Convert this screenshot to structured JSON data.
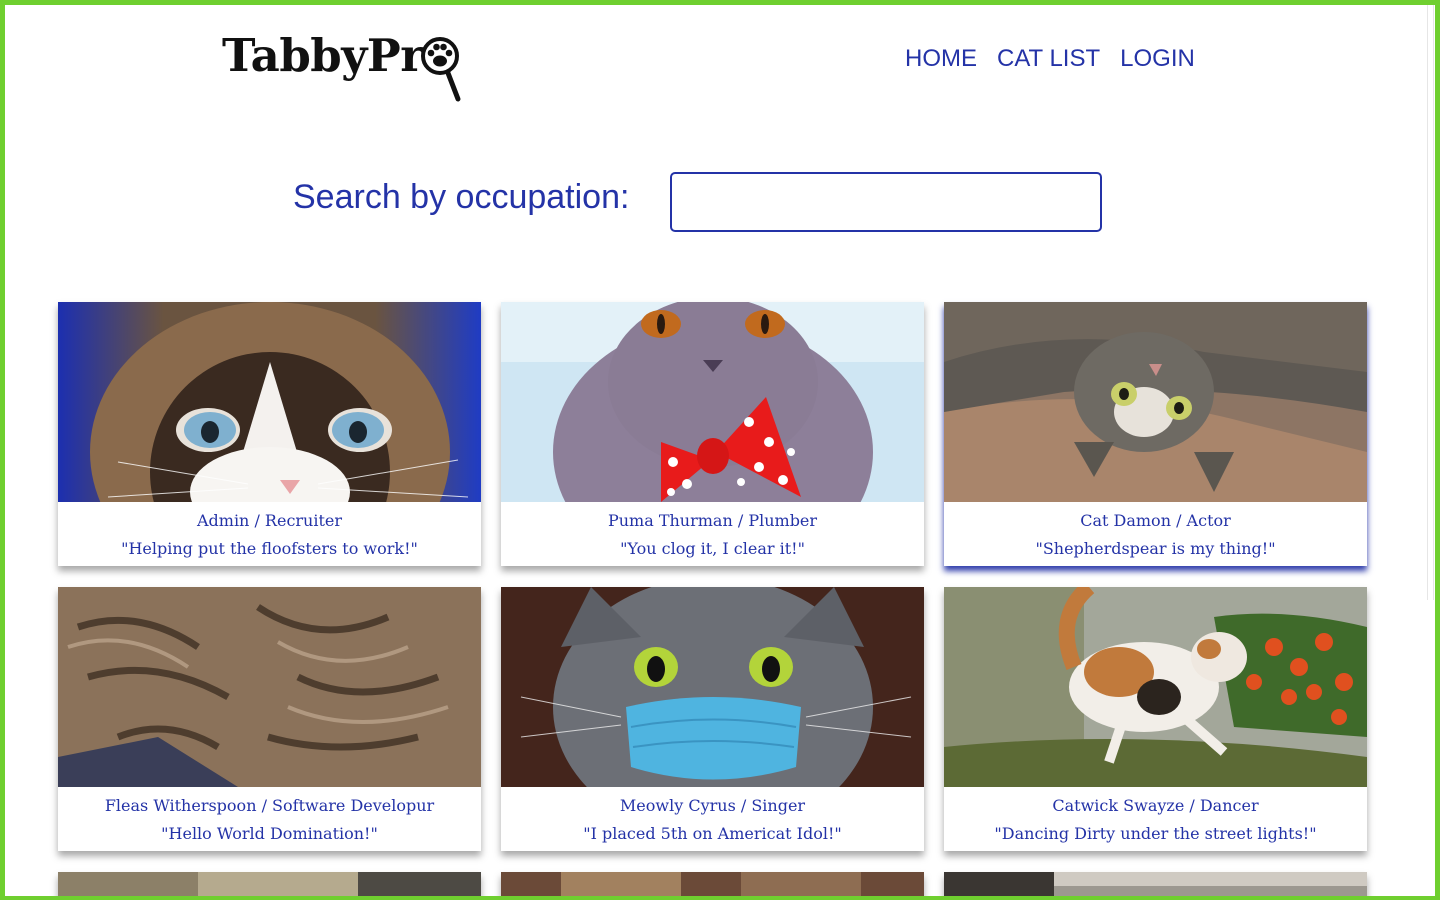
{
  "brand": {
    "name": "TabbyPr"
  },
  "nav": {
    "items": [
      "HOME",
      "CAT LIST",
      "LOGIN"
    ]
  },
  "search": {
    "label": "Search by occupation:",
    "value": "",
    "placeholder": ""
  },
  "cards": [
    {
      "name_role": "Admin / Recruiter",
      "quote": "\"Helping put the floofsters to work!\""
    },
    {
      "name_role": "Puma Thurman / Plumber",
      "quote": "\"You clog it, I clear it!\""
    },
    {
      "name_role": "Cat Damon / Actor",
      "quote": "\"Shepherdspear is my thing!\""
    },
    {
      "name_role": "Fleas Witherspoon / Software Developur",
      "quote": "\"Hello World Domination!\""
    },
    {
      "name_role": "Meowly Cyrus / Singer",
      "quote": "\"I placed 5th on Americat Idol!\""
    },
    {
      "name_role": "Catwick Swayze / Dancer",
      "quote": "\"Dancing Dirty under the street lights!\""
    }
  ],
  "colors": {
    "accent": "#2433a7",
    "frame": "#6fcf2f"
  }
}
